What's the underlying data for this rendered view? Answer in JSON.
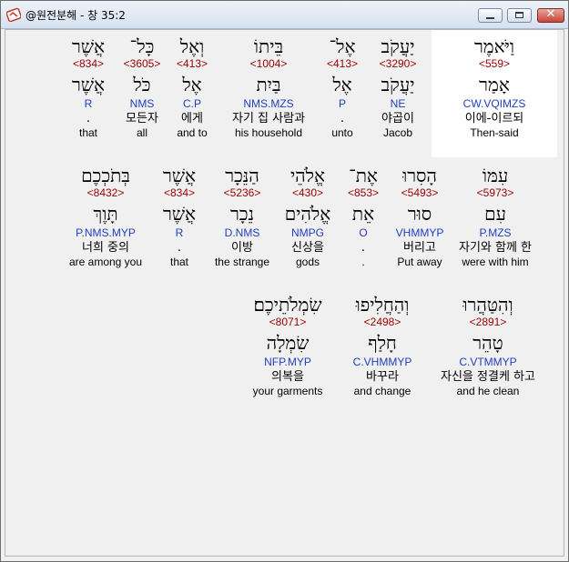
{
  "window": {
    "title": "@원전분해 - 창 35:2",
    "close_glyph": "✕"
  },
  "rows": [
    {
      "words": [
        {
          "heb": "וַיֹּאמֶר",
          "num": "<559>",
          "lemma": "אָמַר",
          "parse": "CW.VQIMZS",
          "kor": "이에-이르되",
          "eng": "Then-said"
        },
        {
          "heb": "יַעֲקֹב",
          "num": "<3290>",
          "lemma": "יַעֲקֹב",
          "parse": "NE",
          "kor": "야곱이",
          "eng": "Jacob"
        },
        {
          "heb": "אֶל־",
          "num": "<413>",
          "lemma": "אֶל",
          "parse": "P",
          "kor": ".",
          "eng": "unto"
        },
        {
          "heb": "בֵּיתוֹ",
          "num": "<1004>",
          "lemma": "בַּיִת",
          "parse": "NMS.MZS",
          "kor": "자기 집 사람과",
          "eng": "his household"
        },
        {
          "heb": "וְאֶל",
          "num": "<413>",
          "lemma": "אֶל",
          "parse": "C.P",
          "kor": "에게",
          "eng": "and to"
        },
        {
          "heb": "כָּל־",
          "num": "<3605>",
          "lemma": "כֹּל",
          "parse": "NMS",
          "kor": "모든자",
          "eng": "all"
        },
        {
          "heb": "אֲשֶׁר",
          "num": "<834>",
          "lemma": "אֲשֶׁר",
          "parse": "R",
          "kor": ".",
          "eng": "that"
        }
      ]
    },
    {
      "words": [
        {
          "heb": "עִמּוֹ",
          "num": "<5973>",
          "lemma": "עִם",
          "parse": "P.MZS",
          "kor": "자기와 함께 한",
          "eng": "were with him"
        },
        {
          "heb": "הָסִרוּ",
          "num": "<5493>",
          "lemma": "סוּר",
          "parse": "VHMMYP",
          "kor": "버리고",
          "eng": "Put away"
        },
        {
          "heb": "אֶת־",
          "num": "<853>",
          "lemma": "אֵת",
          "parse": "O",
          "kor": ".",
          "eng": "."
        },
        {
          "heb": "אֱלֹהֵי",
          "num": "<430>",
          "lemma": "אֱלֹהִים",
          "parse": "NMPG",
          "kor": "신상을",
          "eng": "gods"
        },
        {
          "heb": "הַנֵּכָר",
          "num": "<5236>",
          "lemma": "נֵכָר",
          "parse": "D.NMS",
          "kor": "이방",
          "eng": "the strange"
        },
        {
          "heb": "אֲשֶׁר",
          "num": "<834>",
          "lemma": "אֲשֶׁר",
          "parse": "R",
          "kor": ".",
          "eng": "that"
        },
        {
          "heb": "בְּתֹכְכֶם",
          "num": "<8432>",
          "lemma": "תָּוֶךְ",
          "parse": "P.NMS.MYP",
          "kor": "너희 중의",
          "eng": "are among you"
        }
      ]
    },
    {
      "words": [
        {
          "heb": "וְהִטַּהֲרוּ",
          "num": "<2891>",
          "lemma": "טָהֵר",
          "parse": "C.VTMMYP",
          "kor": "자신을 정결케 하고",
          "eng": "and he clean"
        },
        {
          "heb": "וְהַחֲלִיפוּ",
          "num": "<2498>",
          "lemma": "חָלַף",
          "parse": "C.VHMMYP",
          "kor": "바꾸라",
          "eng": "and change"
        },
        {
          "heb": "שִׂמְלֹתֵיכֶם׃",
          "num": "<8071>",
          "lemma": "שִׂמְלָה",
          "parse": "NFP.MYP",
          "kor": "의복을",
          "eng": "your garments"
        }
      ]
    }
  ]
}
